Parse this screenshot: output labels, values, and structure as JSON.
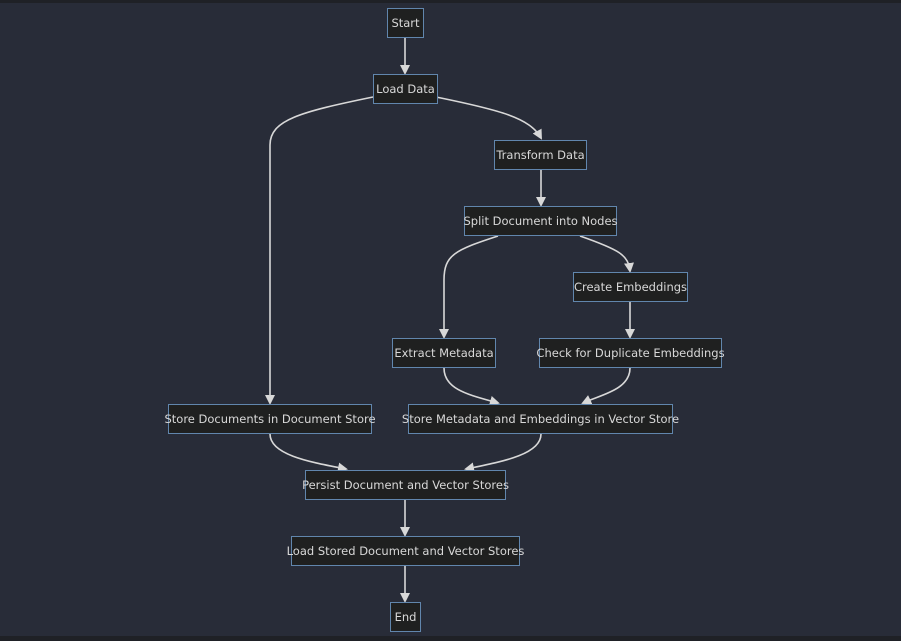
{
  "diagram": {
    "type": "flowchart",
    "nodes": {
      "start": "Start",
      "load_data": "Load Data",
      "transform_data": "Transform Data",
      "split_document": "Split Document into Nodes",
      "create_embeddings": "Create Embeddings",
      "extract_metadata": "Extract Metadata",
      "check_duplicates": "Check for Duplicate Embeddings",
      "store_documents": "Store Documents in Document Store",
      "store_metadata_embeddings": "Store Metadata and Embeddings in Vector Store",
      "persist_stores": "Persist Document and Vector Stores",
      "load_stored": "Load Stored Document and Vector Stores",
      "end": "End"
    },
    "edges": [
      [
        "start",
        "load_data"
      ],
      [
        "load_data",
        "transform_data"
      ],
      [
        "load_data",
        "store_documents"
      ],
      [
        "transform_data",
        "split_document"
      ],
      [
        "split_document",
        "extract_metadata"
      ],
      [
        "split_document",
        "create_embeddings"
      ],
      [
        "create_embeddings",
        "check_duplicates"
      ],
      [
        "extract_metadata",
        "store_metadata_embeddings"
      ],
      [
        "check_duplicates",
        "store_metadata_embeddings"
      ],
      [
        "store_documents",
        "persist_stores"
      ],
      [
        "store_metadata_embeddings",
        "persist_stores"
      ],
      [
        "persist_stores",
        "load_stored"
      ],
      [
        "load_stored",
        "end"
      ]
    ],
    "colors": {
      "background": "#282c38",
      "node_fill": "#1f2020",
      "node_border": "#6186ad",
      "edge": "#d8d8d8",
      "text": "#d8d8d8"
    }
  }
}
